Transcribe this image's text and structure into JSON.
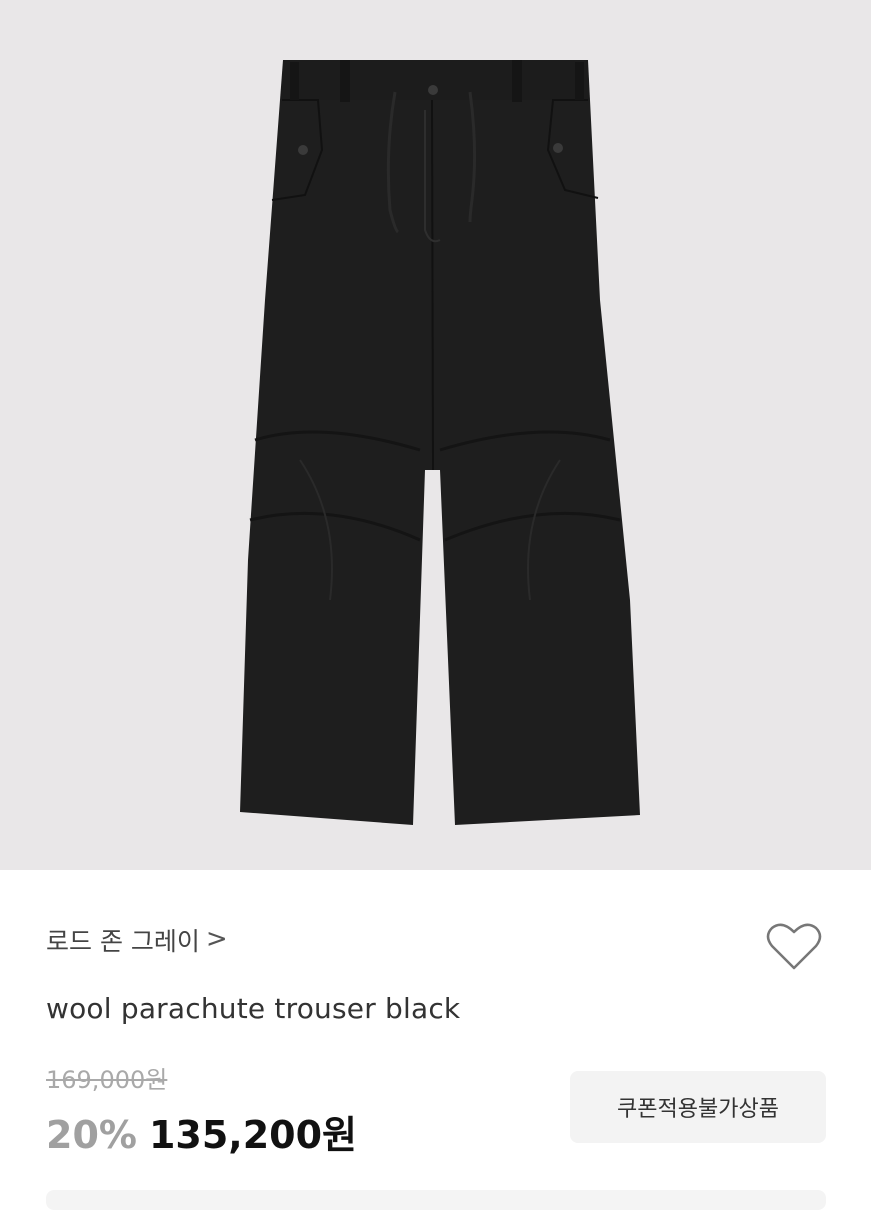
{
  "product": {
    "image_alt": "wool parachute trouser black",
    "brand": "로드 존 그레이",
    "brand_chevron": ">",
    "name": "wool parachute trouser black",
    "original_price": "169,000원",
    "discount": "20%",
    "price": "135,200원",
    "coupon_notice": "쿠폰적용불가상품"
  },
  "icons": {
    "wishlist": "heart-outline-icon",
    "brand_arrow": "chevron-right-icon"
  },
  "colors": {
    "hero_bg": "#e9e7e8",
    "discount": "#a0a0a0",
    "price": "#111111",
    "strike": "#a9a9a9"
  }
}
